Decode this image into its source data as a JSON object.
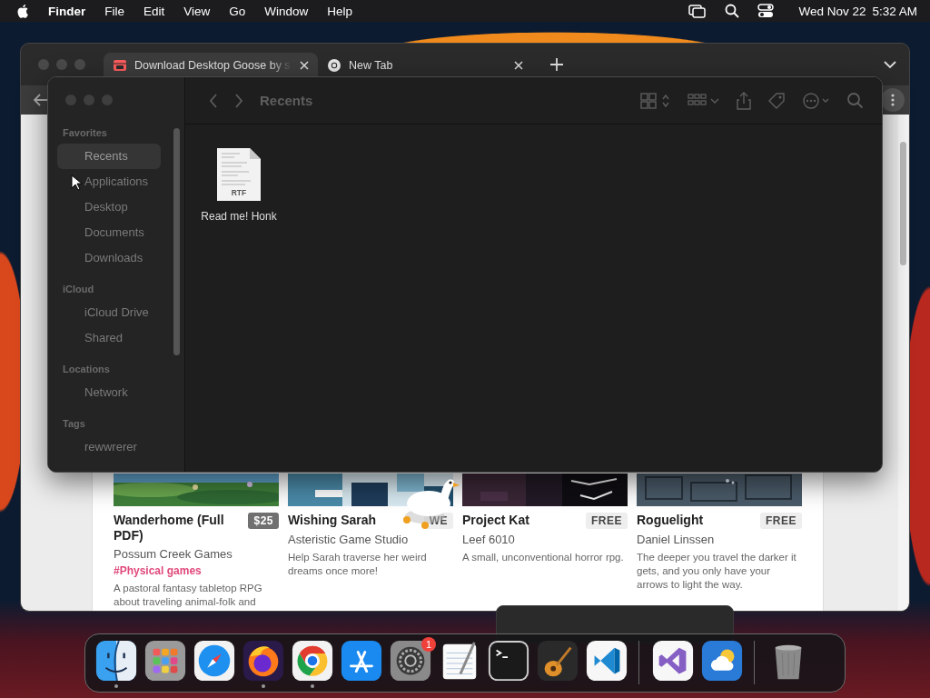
{
  "menubar": {
    "app": "Finder",
    "menus": [
      "File",
      "Edit",
      "View",
      "Go",
      "Window",
      "Help"
    ],
    "date": "Wed Nov 22",
    "time": "5:32 AM"
  },
  "browser": {
    "tabs": [
      {
        "title": "Download Desktop Goose by s",
        "selected": true,
        "kind": "store"
      },
      {
        "title": "New Tab",
        "selected": false,
        "kind": "chrome"
      }
    ],
    "cards": [
      {
        "title": "Wanderhome (Full PDF)",
        "price": "$25",
        "paid": true,
        "author": "Possum Creek Games",
        "tag": "#Physical games",
        "description": "A pastoral fantasy tabletop RPG about traveling animal-folk and",
        "kind": "meadow"
      },
      {
        "title": "Wishing Sarah",
        "price": "WE",
        "paid": false,
        "author": "Asteristic Game Studio",
        "description": "Help Sarah traverse her weird dreams once more!",
        "kind": "pixel"
      },
      {
        "title": "Project Kat",
        "price": "FREE",
        "paid": false,
        "author": "Leef 6010",
        "description": "A small, unconventional horror rpg.",
        "kind": "night"
      },
      {
        "title": "Roguelight",
        "price": "FREE",
        "paid": false,
        "author": "Daniel Linssen",
        "description": "The deeper you travel the darker it gets, and you only have your arrows to light the way.",
        "kind": "dungeon"
      }
    ]
  },
  "finder": {
    "title": "Recents",
    "sidebar": [
      {
        "heading": "Favorites",
        "items": [
          {
            "label": "Recents",
            "selected": true
          },
          {
            "label": "Applications",
            "selected": false
          },
          {
            "label": "Desktop",
            "selected": false
          },
          {
            "label": "Documents",
            "selected": false
          },
          {
            "label": "Downloads",
            "selected": false
          }
        ]
      },
      {
        "heading": "iCloud",
        "items": [
          {
            "label": "iCloud Drive",
            "selected": false
          },
          {
            "label": "Shared",
            "selected": false
          }
        ]
      },
      {
        "heading": "Locations",
        "items": [
          {
            "label": "Network",
            "selected": false
          }
        ]
      },
      {
        "heading": "Tags",
        "items": [
          {
            "label": "rewwrerer",
            "selected": false
          }
        ]
      }
    ],
    "files": [
      {
        "name": "Read me! Honk",
        "type": "RTF"
      }
    ]
  },
  "dock": {
    "items": [
      {
        "kind": "finder",
        "running": true
      },
      {
        "kind": "launchpad",
        "running": false
      },
      {
        "kind": "safari",
        "running": false
      },
      {
        "kind": "firefox",
        "running": true
      },
      {
        "kind": "chrome",
        "running": true
      },
      {
        "kind": "appstore",
        "running": false
      },
      {
        "kind": "settings",
        "running": false,
        "badge": "1"
      },
      {
        "kind": "textedit",
        "running": false
      },
      {
        "kind": "terminal",
        "running": false
      },
      {
        "kind": "garageband",
        "running": false
      },
      {
        "kind": "vscode",
        "running": false,
        "separator_after": true
      },
      {
        "kind": "visualstudio",
        "running": false
      },
      {
        "kind": "weather",
        "running": false,
        "separator_after": true
      },
      {
        "kind": "trash",
        "running": false
      }
    ]
  }
}
